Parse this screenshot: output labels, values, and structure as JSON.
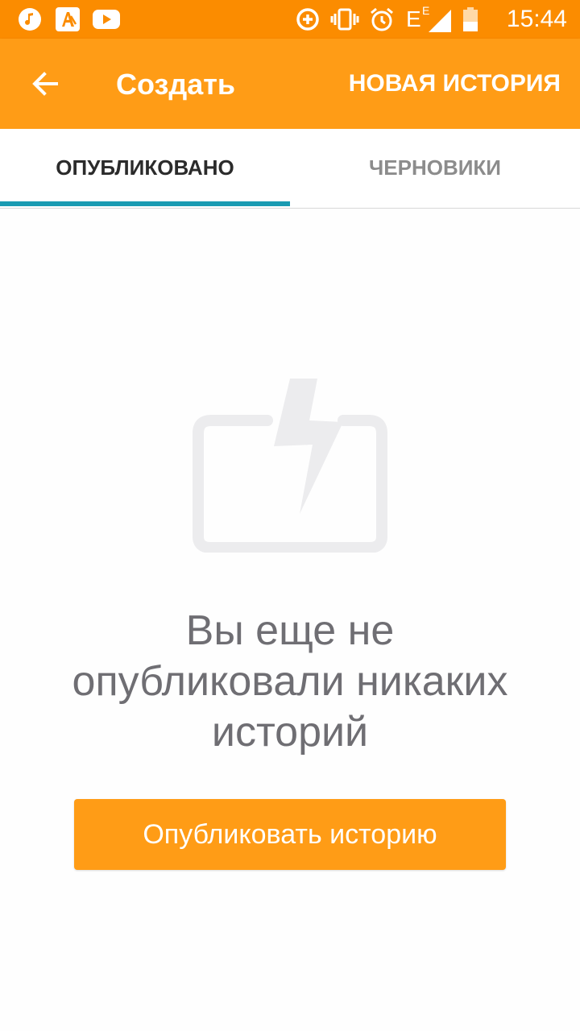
{
  "status_bar": {
    "time": "15:44",
    "network_label": "E",
    "icons": [
      "music-icon",
      "app-icon",
      "youtube-icon",
      "data-saver-icon",
      "vibrate-icon",
      "alarm-icon",
      "signal-icon",
      "battery-icon"
    ]
  },
  "app_bar": {
    "title": "Создать",
    "action_label": "НОВАЯ ИСТОРИЯ",
    "back_icon": "arrow-back-icon"
  },
  "tabs": [
    {
      "label": "ОПУБЛИКОВАНО",
      "selected": true
    },
    {
      "label": "ЧЕРНОВИКИ",
      "selected": false
    }
  ],
  "empty_state": {
    "icon": "story-lightning-icon",
    "line1": "Вы еще не",
    "line2": "опубликовали никаких",
    "line3": "историй",
    "button_label": "Опубликовать историю"
  },
  "colors": {
    "status_bar": "#fb8c00",
    "app_bar": "#ff9c16",
    "tab_indicator": "#1a9bb2",
    "button": "#ff9c16",
    "message_text": "#6f6e73",
    "illustration": "#ececee"
  }
}
